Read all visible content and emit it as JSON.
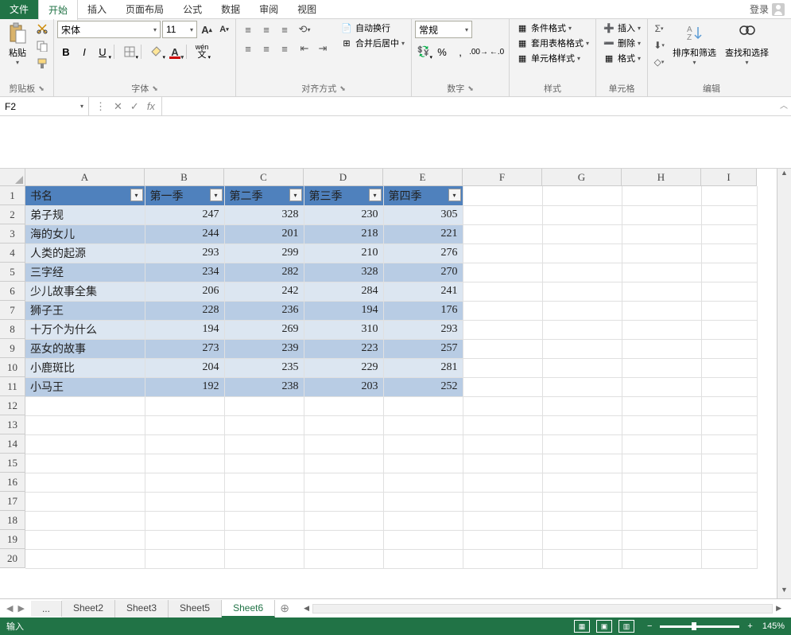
{
  "menu": {
    "tabs": [
      "文件",
      "开始",
      "插入",
      "页面布局",
      "公式",
      "数据",
      "审阅",
      "视图"
    ],
    "active": 1,
    "login": "登录"
  },
  "ribbon": {
    "clipboard": {
      "paste": "粘贴",
      "label": "剪贴板"
    },
    "font": {
      "name": "宋体",
      "size": "11",
      "label": "字体",
      "wen": "wén"
    },
    "align": {
      "label": "对齐方式",
      "wrap": "自动换行",
      "merge": "合并后居中"
    },
    "number": {
      "format": "常规",
      "label": "数字"
    },
    "styles": {
      "cond": "条件格式",
      "tablefmt": "套用表格格式",
      "cellstyle": "单元格样式",
      "label": "样式"
    },
    "cells": {
      "insert": "插入",
      "delete": "删除",
      "format": "格式",
      "label": "单元格"
    },
    "editing": {
      "sort": "排序和筛选",
      "find": "查找和选择",
      "label": "编辑"
    }
  },
  "namebox": "F2",
  "columns": [
    "A",
    "B",
    "C",
    "D",
    "E",
    "F",
    "G",
    "H",
    "I"
  ],
  "table": {
    "headers": [
      "书名",
      "第一季",
      "第二季",
      "第三季",
      "第四季"
    ],
    "rows": [
      {
        "name": "弟子规",
        "q": [
          247,
          328,
          230,
          305
        ]
      },
      {
        "name": "海的女儿",
        "q": [
          244,
          201,
          218,
          221
        ]
      },
      {
        "name": "人类的起源",
        "q": [
          293,
          299,
          210,
          276
        ]
      },
      {
        "name": "三字经",
        "q": [
          234,
          282,
          328,
          270
        ]
      },
      {
        "name": "少儿故事全集",
        "q": [
          206,
          242,
          284,
          241
        ]
      },
      {
        "name": "狮子王",
        "q": [
          228,
          236,
          194,
          176
        ]
      },
      {
        "name": "十万个为什么",
        "q": [
          194,
          269,
          310,
          293
        ]
      },
      {
        "name": "巫女的故事",
        "q": [
          273,
          239,
          223,
          257
        ]
      },
      {
        "name": "小鹿斑比",
        "q": [
          204,
          235,
          229,
          281
        ]
      },
      {
        "name": "小马王",
        "q": [
          192,
          238,
          203,
          252
        ]
      }
    ]
  },
  "sheets": {
    "more": "...",
    "tabs": [
      "Sheet2",
      "Sheet3",
      "Sheet5",
      "Sheet6"
    ],
    "active": 3
  },
  "status": {
    "mode": "输入",
    "zoom": "145%"
  }
}
